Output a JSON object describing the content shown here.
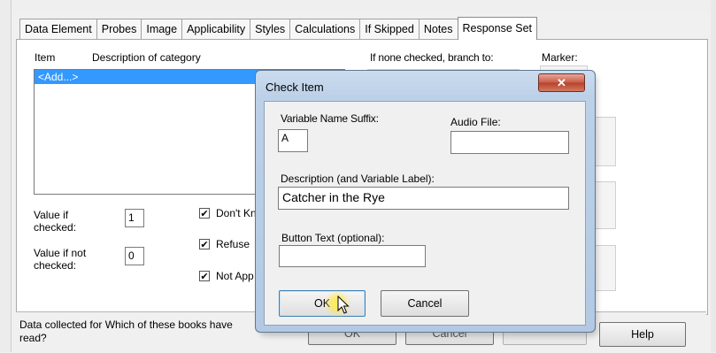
{
  "tabs": [
    {
      "label": "Data Element"
    },
    {
      "label": "Probes"
    },
    {
      "label": "Image"
    },
    {
      "label": "Applicability"
    },
    {
      "label": "Styles"
    },
    {
      "label": "Calculations"
    },
    {
      "label": "If Skipped"
    },
    {
      "label": "Notes"
    },
    {
      "label": "Response Set"
    }
  ],
  "active_tab": "Response Set",
  "response_set": {
    "col_item": "Item",
    "col_description": "Description of category",
    "col_branch": "If none checked, branch to:",
    "col_marker": "Marker:",
    "list_items": [
      "<Add...>"
    ],
    "value_if_checked_label": "Value if checked:",
    "value_if_checked": "1",
    "value_if_not_checked_label": "Value if not checked:",
    "value_if_not_checked": "0",
    "checkboxes": [
      {
        "label": "Don't Kn",
        "checked": true
      },
      {
        "label": "Refuse",
        "checked": true
      },
      {
        "label": "Not App",
        "checked": true
      }
    ]
  },
  "footer": {
    "status_text": "Data collected for Which of these books have read?",
    "status_line1": "Data collected for Which of these books have",
    "status_line2": "read?",
    "ok_label": "OK",
    "cancel_label": "Cancel",
    "help_label": "Help"
  },
  "dialog": {
    "title": "Check Item",
    "close_glyph": "✕",
    "suffix_label": "Variable Name Suffix:",
    "suffix_value": "A",
    "audio_label": "Audio File:",
    "audio_value": "",
    "description_label": "Description (and Variable Label):",
    "description_value": "Catcher in the Rye",
    "button_text_label": "Button Text (optional):",
    "button_text_value": "",
    "ok_label": "OK",
    "cancel_label": "Cancel"
  }
}
